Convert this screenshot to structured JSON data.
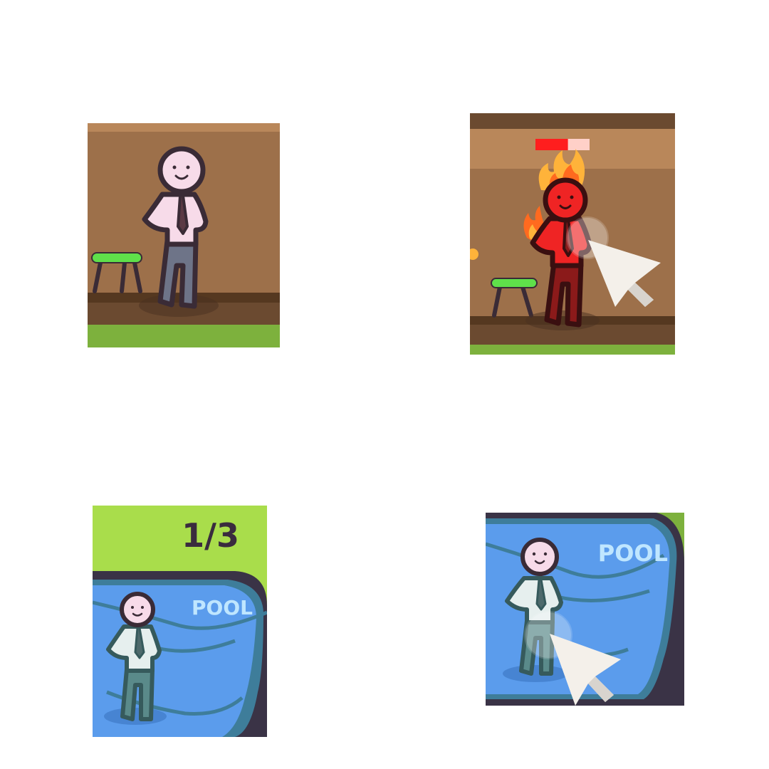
{
  "panels": [
    {
      "id": "room-idle",
      "scene": "room"
    },
    {
      "id": "room-burning",
      "scene": "room",
      "health_level": 0.6
    },
    {
      "id": "pool-counter",
      "scene": "pool",
      "counter_text": "1/3",
      "pool_label": "POOL"
    },
    {
      "id": "pool-pointer",
      "scene": "pool",
      "pool_label": "POOL"
    }
  ],
  "colors": {
    "wall": "#9d704a",
    "wall_top": "#b9875a",
    "floor": "#6b4a30",
    "grass": "#7db13d",
    "grass_light": "#a9dd4b",
    "stool": "#5fe04a",
    "water": "#5b9cec",
    "water_rim": "#3e7d9a",
    "outline": "#3a2b36",
    "skin": "#f7dbe9",
    "pants": "#6e7488",
    "burning": "#ef2424",
    "fire": "#ffb33a",
    "health_fill": "#ff1e1e",
    "health_empty": "#ffd0c8",
    "pointer": "#f4f0ea"
  }
}
